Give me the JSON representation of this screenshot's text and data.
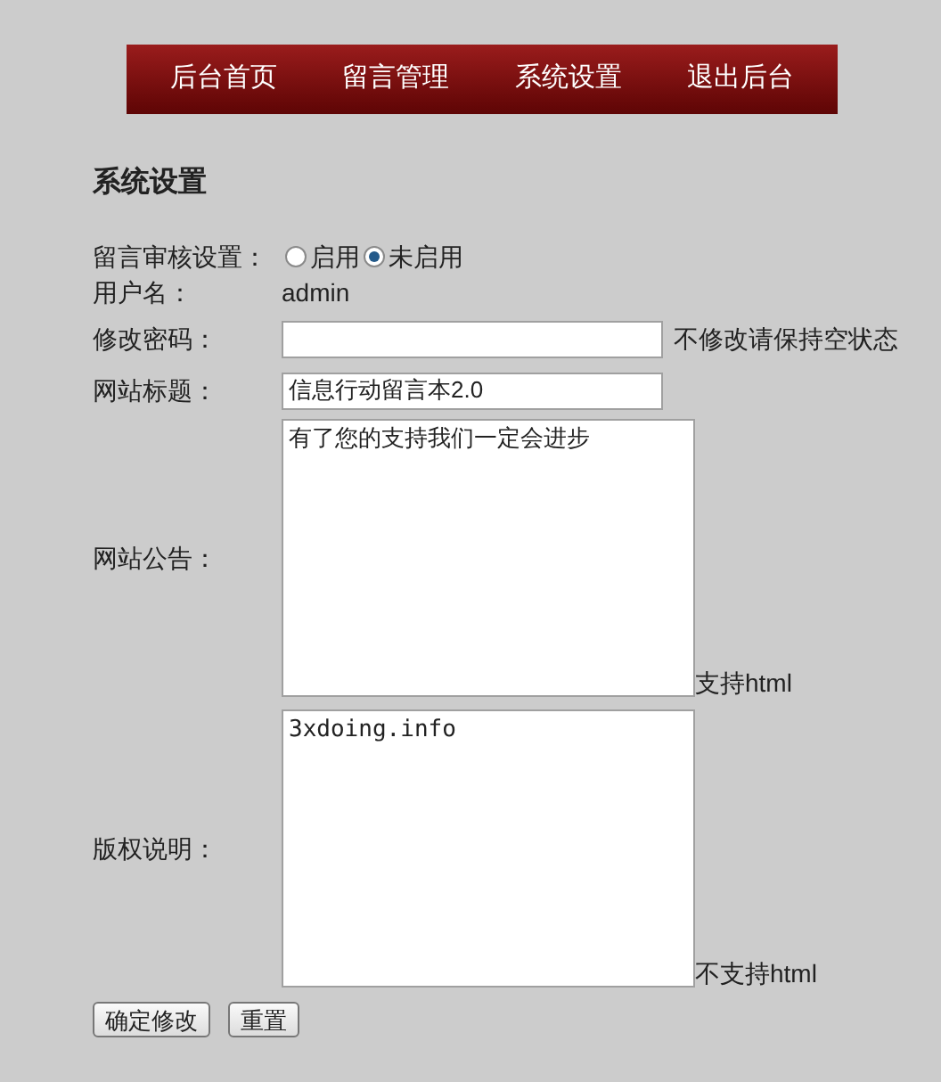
{
  "nav": [
    {
      "label": "后台首页",
      "selected": false
    },
    {
      "label": "留言管理",
      "selected": false
    },
    {
      "label": "系统设置",
      "selected": false
    },
    {
      "label": "退出后台",
      "selected": false
    }
  ],
  "heading": "系统设置",
  "form": {
    "review": {
      "label": "留言审核设置：",
      "options": [
        {
          "label": "启用",
          "selected": false
        },
        {
          "label": "未启用",
          "selected": true
        }
      ]
    },
    "username": {
      "label": "用户名：",
      "value": "admin"
    },
    "password": {
      "label": "修改密码：",
      "hint": "不修改请保持空状态"
    },
    "site_title": {
      "label": "网站标题：",
      "value": "信息行动留言本2.0"
    },
    "notice": {
      "label": "网站公告：",
      "value": "有了您的支持我们一定会进步",
      "hint": "支持html"
    },
    "copyright": {
      "label": "版权说明：",
      "value": "3xdoing.info",
      "hint": "不支持html"
    }
  },
  "buttons": [
    "确定修改",
    "重置"
  ]
}
